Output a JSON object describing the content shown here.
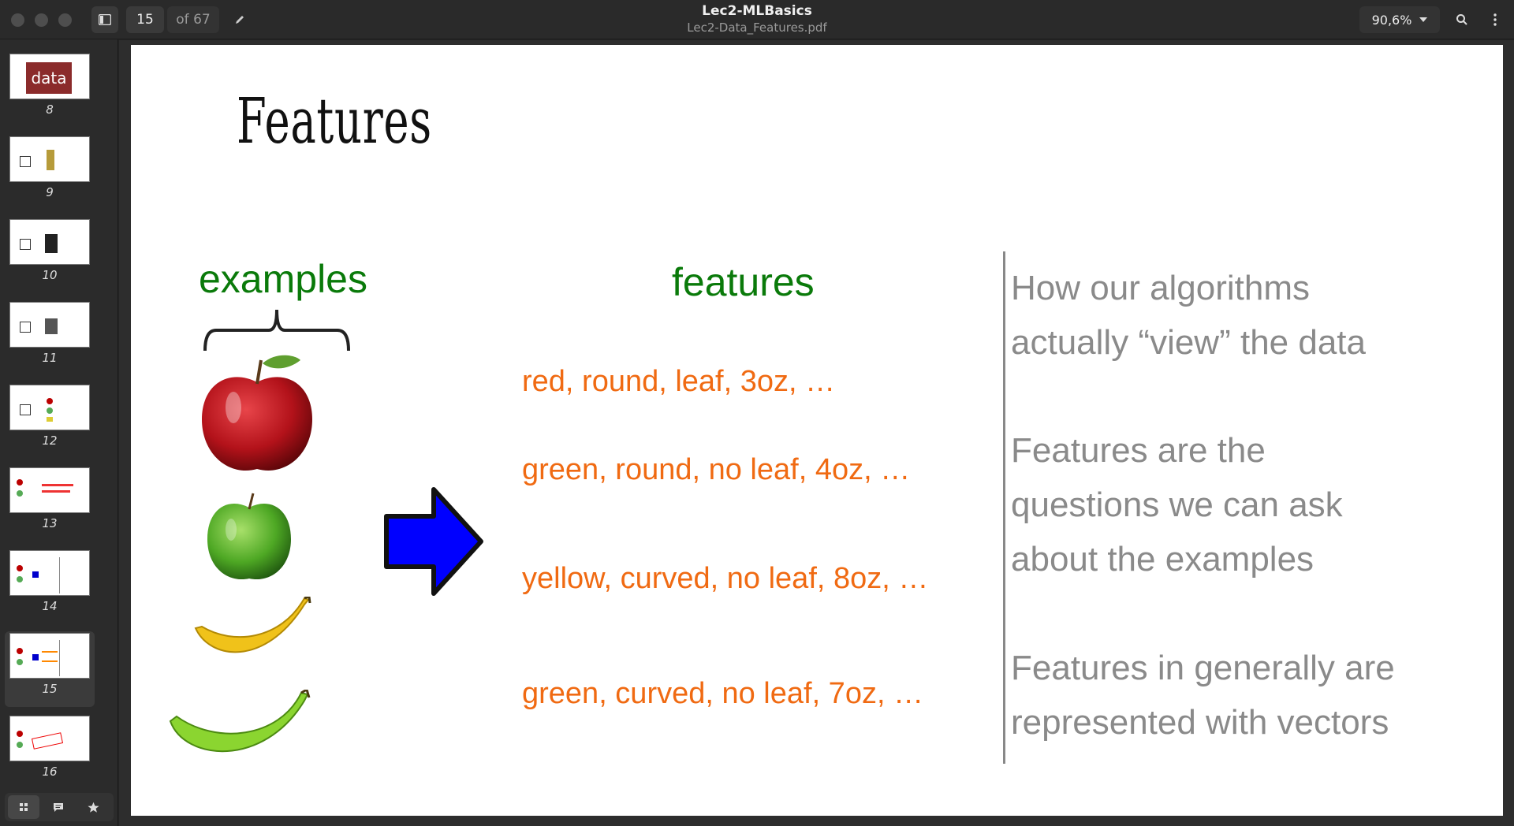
{
  "header": {
    "page_current": "15",
    "page_of": "of 67",
    "title": "Lec2-MLBasics",
    "subtitle": "Lec2-Data_Features.pdf",
    "zoom": "90,6%",
    "icons": [
      "sidebar-toggle-icon",
      "pencil-icon",
      "search-icon",
      "more-icon",
      "chevron-down-icon"
    ]
  },
  "thumbnails": [
    {
      "num": "8",
      "mini": "data"
    },
    {
      "num": "9"
    },
    {
      "num": "10"
    },
    {
      "num": "11"
    },
    {
      "num": "12"
    },
    {
      "num": "13"
    },
    {
      "num": "14"
    },
    {
      "num": "15",
      "selected": true
    },
    {
      "num": "16"
    }
  ],
  "sidebar_bottom": [
    "grid-icon",
    "comment-icon",
    "star-icon"
  ],
  "slide": {
    "title": "Features",
    "examples_label": "examples",
    "features_label": "features",
    "feature_rows": [
      "red, round, leaf, 3oz, …",
      "green, round, no leaf, 4oz, …",
      "yellow, curved, no leaf, 8oz, …",
      "green, curved, no leaf, 7oz, …"
    ],
    "notes": [
      [
        "How our algorithms",
        "actually “view” the data"
      ],
      [
        "Features are the",
        "questions we can ask",
        "about the examples"
      ],
      [
        "Features in generally are",
        "represented with vectors"
      ]
    ],
    "colors": {
      "green": "#0a7a0a",
      "orange": "#f06a12",
      "gray": "#8a8a8a",
      "arrow": "#0000ff"
    }
  }
}
